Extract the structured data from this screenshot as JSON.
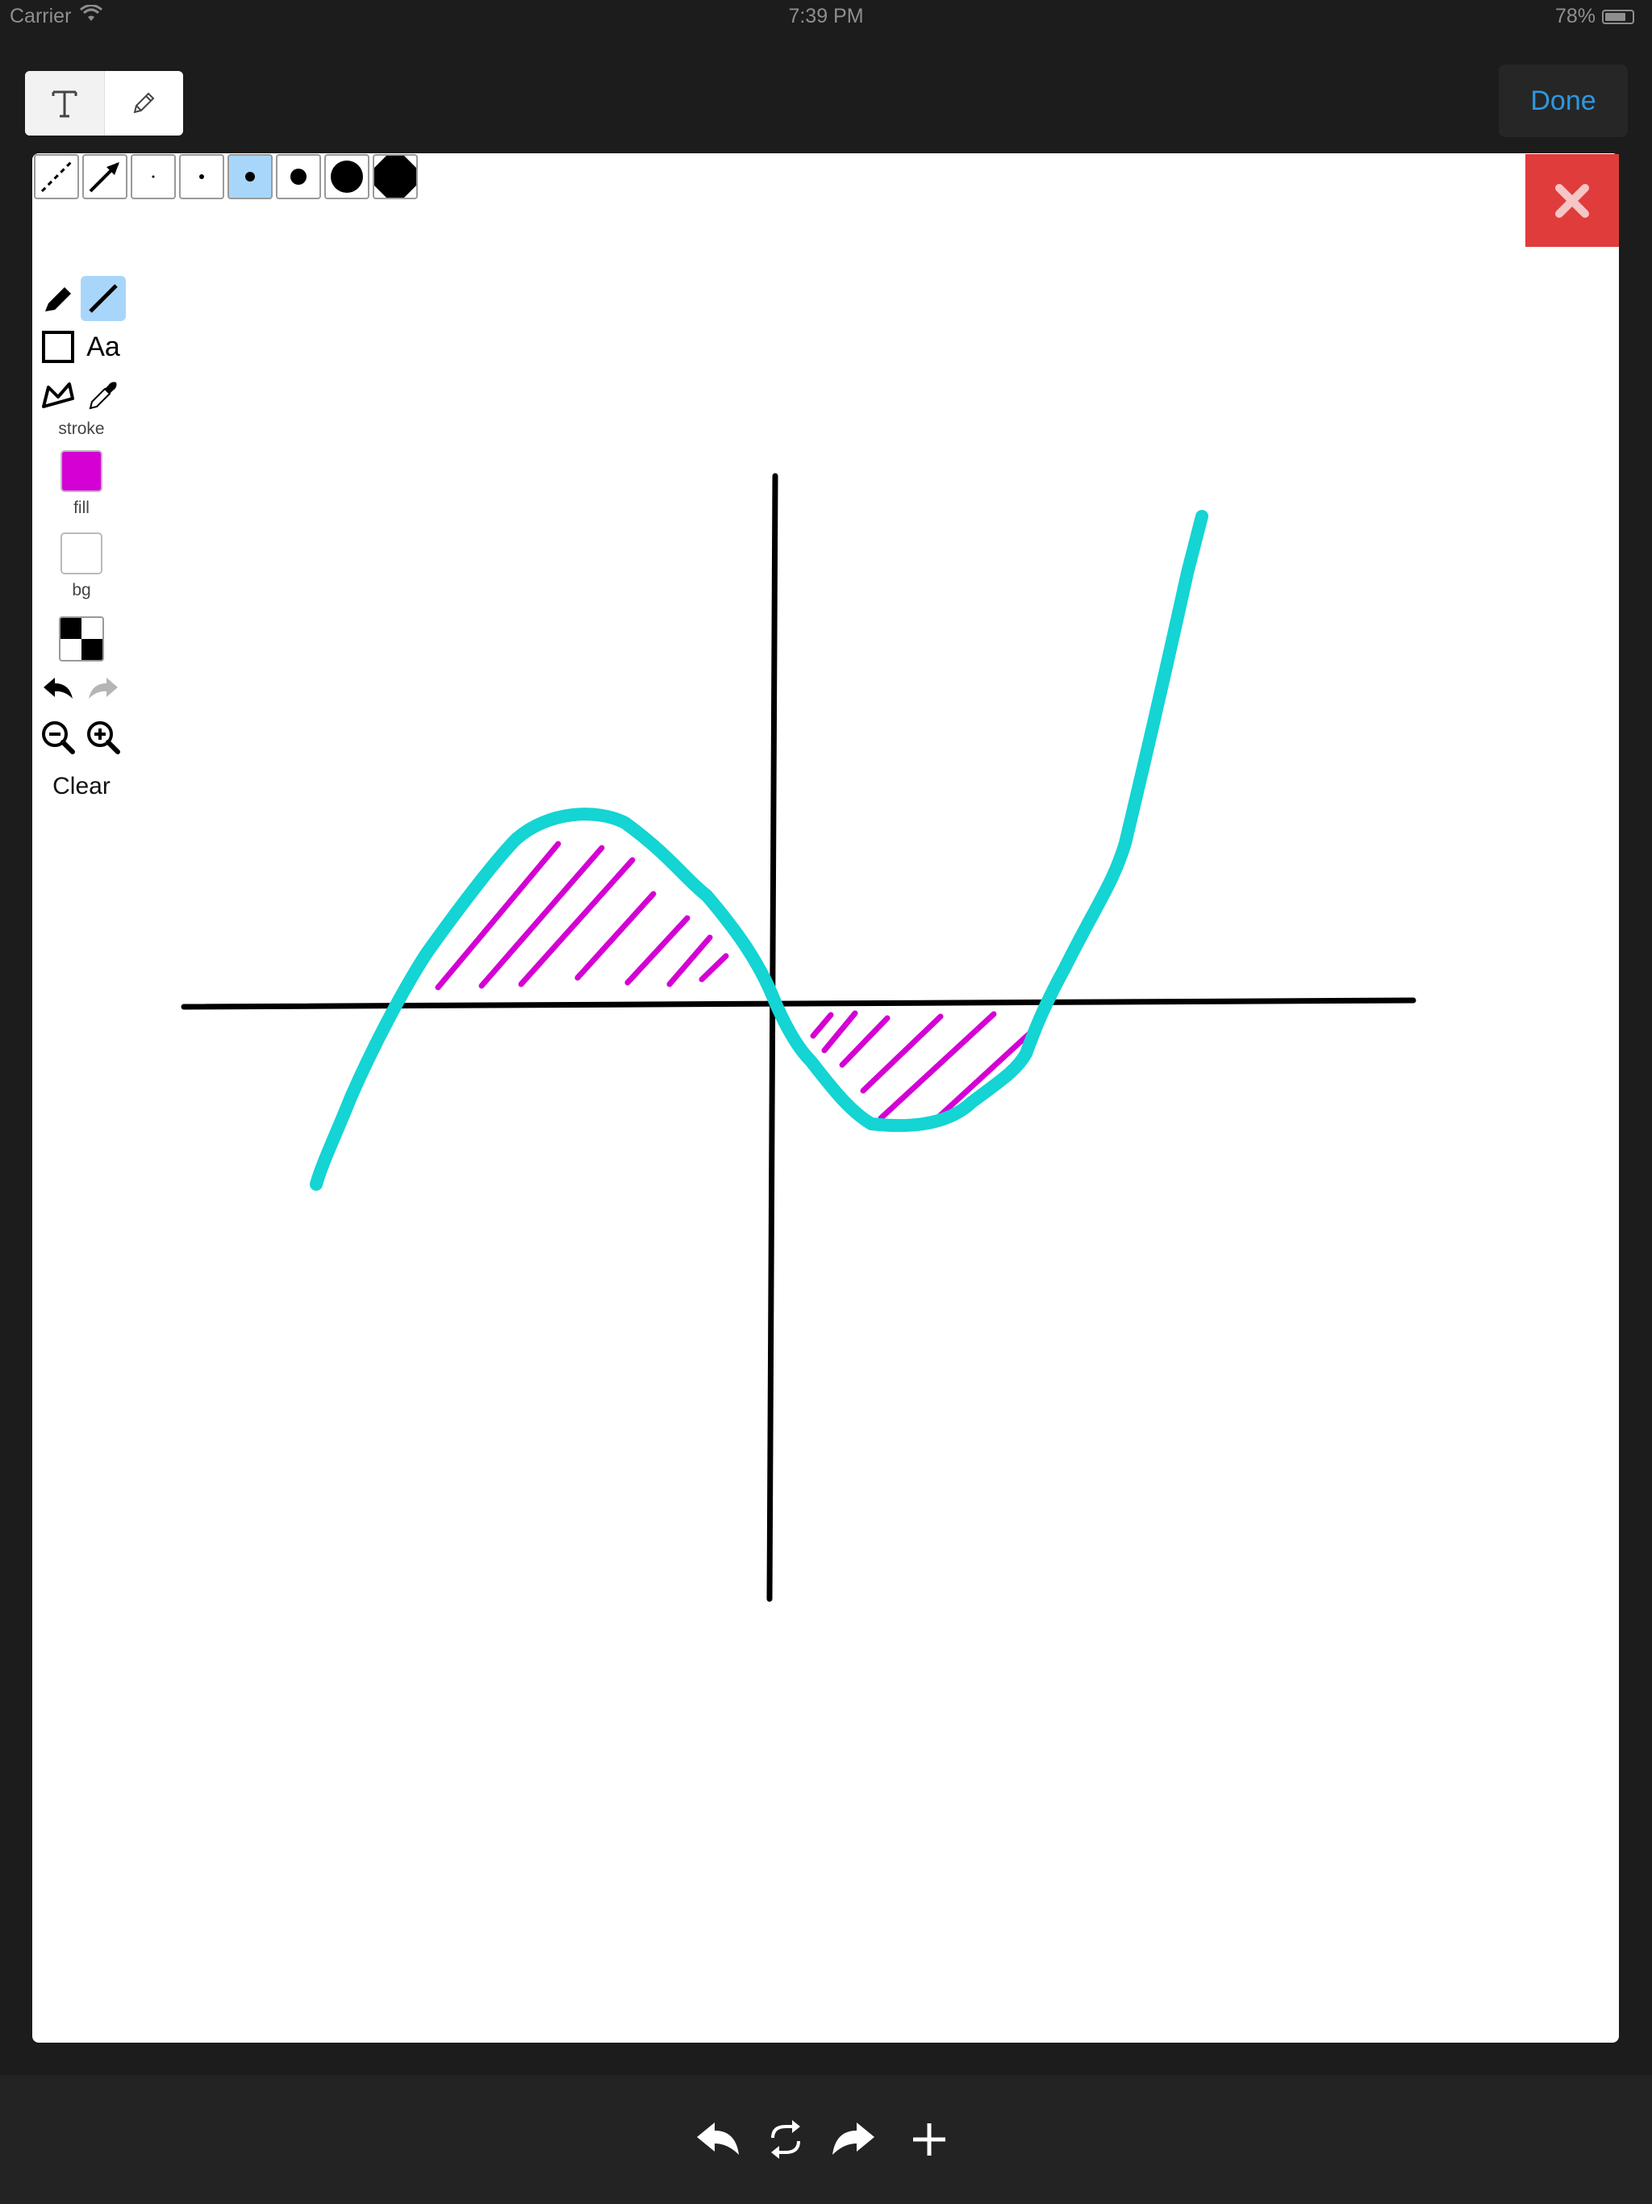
{
  "status": {
    "carrier": "Carrier",
    "time": "7:39 PM",
    "battery": "78%",
    "battery_level": 0.78
  },
  "mode": {
    "items": [
      {
        "name": "text-mode",
        "icon": "T",
        "selected": true
      },
      {
        "name": "draw-mode",
        "icon": "pencil-icon",
        "selected": false
      }
    ]
  },
  "header": {
    "done_label": "Done"
  },
  "canvas": {
    "close_icon": "close-icon",
    "close_color": "#e03c3c"
  },
  "size_options": {
    "selected": "medium-dot",
    "items": [
      "dashed-line",
      "arrow",
      "tiny-dot",
      "small-dot",
      "medium-dot",
      "large-dot",
      "xlarge-dot",
      "xxlarge-dot"
    ]
  },
  "tools": {
    "selected": "line",
    "items": [
      "pencil",
      "line",
      "rectangle",
      "text",
      "polygon",
      "eyedropper"
    ],
    "text_tool_label": "Aa",
    "stroke_label": "stroke",
    "stroke_color": "#d400d4",
    "fill_label": "fill",
    "fill_color": "#ffffff",
    "bg_label": "bg",
    "bg_color": "#ffffff",
    "clear_label": "Clear"
  },
  "drawing": {
    "axis_color": "#000000",
    "curve_color": "#14d4d4",
    "hatch_color": "#d400d4"
  },
  "bottom": {
    "items": [
      "undo-icon",
      "refresh-icon",
      "redo-icon",
      "plus-icon"
    ]
  }
}
